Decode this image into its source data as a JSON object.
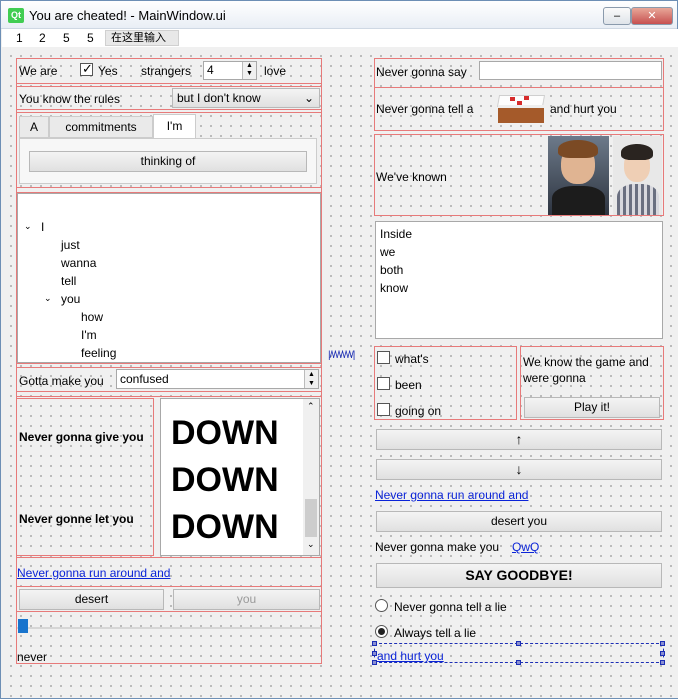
{
  "window": {
    "title": "You are cheated! - MainWindow.ui",
    "logo": "Qt"
  },
  "menubar": {
    "items": [
      "1",
      "2",
      "5",
      "5"
    ],
    "input_placeholder": "在这里输入"
  },
  "left": {
    "row1": {
      "label1": "We are",
      "checkbox_label": "Yes",
      "checked": true,
      "label2": "strangers",
      "spin_value": "4",
      "label3": "love"
    },
    "row2": {
      "label": "You know the rules",
      "combo_value": "but I don't know"
    },
    "tabs": {
      "items": [
        "A",
        "commitments",
        "I'm"
      ],
      "active_index": 2,
      "button_label": "thinking of"
    },
    "tree": {
      "items": [
        {
          "text": "I",
          "depth": 0,
          "expanded": true
        },
        {
          "text": "just",
          "depth": 1
        },
        {
          "text": "wanna",
          "depth": 1
        },
        {
          "text": "tell",
          "depth": 1
        },
        {
          "text": "you",
          "depth": 1,
          "expanded": true
        },
        {
          "text": "how",
          "depth": 2
        },
        {
          "text": "I'm",
          "depth": 2
        },
        {
          "text": "feeling",
          "depth": 2
        }
      ]
    },
    "gotta": {
      "label": "Gotta make you",
      "value": "confused"
    },
    "labels_bold": [
      "Never gonna give you",
      "Never gonne let you"
    ],
    "down_items": [
      "DOWN",
      "DOWN",
      "DOWN"
    ],
    "link": "Never gonna run around and",
    "buttons": {
      "desert": "desert",
      "you": "you"
    },
    "slider_value": 0,
    "bottom_label": "never"
  },
  "right": {
    "say": {
      "label": "Never gonna say",
      "value": ""
    },
    "tell": {
      "label_before": "Never gonna tell a",
      "label_after": "and hurt you"
    },
    "known": {
      "label": "We've known"
    },
    "textedit": {
      "lines": [
        "Inside",
        "we",
        "both",
        "know"
      ]
    },
    "checks": [
      {
        "label": "what's",
        "checked": false
      },
      {
        "label": "been",
        "checked": false
      },
      {
        "label": "going on",
        "checked": false
      }
    ],
    "game": {
      "text": "We know the game and were gonna",
      "button": "Play it!"
    },
    "arrows": {
      "up": "↑",
      "down": "↓"
    },
    "link1": "Never gonna run around and",
    "desert_button": "desert you",
    "make": {
      "label": "Never gonna make you",
      "link": "QwQ"
    },
    "goodbye": "SAY GOODBYE!",
    "radios": [
      {
        "label": "Never gonna tell a lie",
        "checked": false
      },
      {
        "label": "Always tell a lie",
        "checked": true
      }
    ],
    "hurt_link": "and hurt you"
  },
  "colors": {
    "red_border": "#e77a7a",
    "link": "#0b24d8",
    "selection": "#1b2db4"
  }
}
